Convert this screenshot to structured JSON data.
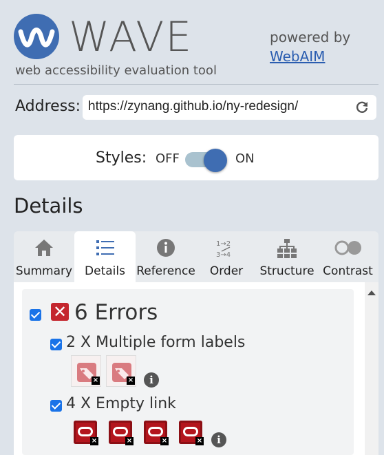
{
  "header": {
    "brand": "WAVE",
    "tagline": "web accessibility evaluation tool",
    "powered_by": "powered by",
    "webaim_link": "WebAIM"
  },
  "address": {
    "label": "Address:",
    "value": "https://zynang.github.io/ny-redesign/"
  },
  "styles": {
    "label": "Styles:",
    "off": "OFF",
    "on": "ON",
    "state": "on"
  },
  "section_title": "Details",
  "tabs": [
    {
      "label": "Summary",
      "icon": "home-icon"
    },
    {
      "label": "Details",
      "icon": "list-icon",
      "active": true
    },
    {
      "label": "Reference",
      "icon": "info-icon"
    },
    {
      "label": "Order",
      "icon": "order-icon"
    },
    {
      "label": "Structure",
      "icon": "structure-icon"
    },
    {
      "label": "Contrast",
      "icon": "contrast-icon"
    }
  ],
  "errors": {
    "title": "6 Errors",
    "items": [
      {
        "title": "2 X Multiple form labels",
        "count": 2
      },
      {
        "title": "4 X Empty link",
        "count": 4
      }
    ]
  },
  "colors": {
    "accent": "#3f6db2",
    "error": "#c4262e",
    "link": "#2a5db0"
  }
}
